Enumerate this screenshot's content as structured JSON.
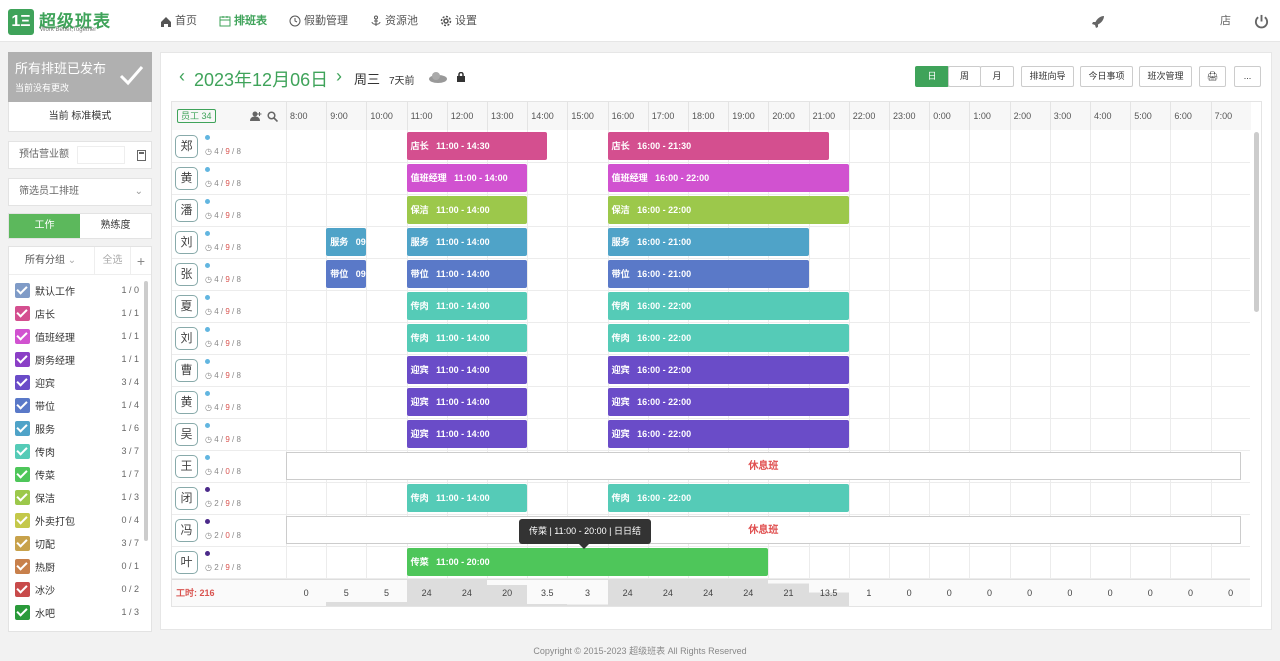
{
  "brand": {
    "logo_letter": "1Ξ",
    "name": "超级班表",
    "tagline": "Work Better,Together"
  },
  "nav": [
    {
      "label": "首页",
      "icon": "home-icon"
    },
    {
      "label": "排班表",
      "icon": "calendar-icon",
      "active": true
    },
    {
      "label": "假勤管理",
      "icon": "clock-icon"
    },
    {
      "label": "资源池",
      "icon": "anchor-icon"
    },
    {
      "label": "设置",
      "icon": "gear-icon"
    }
  ],
  "top_right": {
    "store_label": "店"
  },
  "publish": {
    "title": "所有排班已发布",
    "subtitle": "当前没有更改"
  },
  "mode_label": "当前 标准模式",
  "revenue_label": "预估营业额",
  "filter_label": "筛选员工排班",
  "tabs": [
    "工作",
    "熟练度"
  ],
  "group_head": {
    "all": "所有分组",
    "select_all": "全选",
    "add": "+"
  },
  "groups": [
    {
      "name": "默认工作",
      "count": "1 / 0",
      "color": "#7f9bc7"
    },
    {
      "name": "店长",
      "count": "1 / 1",
      "color": "#d44f8f"
    },
    {
      "name": "值班经理",
      "count": "1 / 1",
      "color": "#d152d0"
    },
    {
      "name": "厨务经理",
      "count": "1 / 1",
      "color": "#8b3fc6"
    },
    {
      "name": "迎宾",
      "count": "3 / 4",
      "color": "#6a4cc8"
    },
    {
      "name": "带位",
      "count": "1 / 4",
      "color": "#5a79c8"
    },
    {
      "name": "服务",
      "count": "1 / 6",
      "color": "#4fa3c8"
    },
    {
      "name": "传肉",
      "count": "3 / 7",
      "color": "#55cbb7"
    },
    {
      "name": "传菜",
      "count": "1 / 7",
      "color": "#4ec65a"
    },
    {
      "name": "保洁",
      "count": "1 / 3",
      "color": "#9cc84b"
    },
    {
      "name": "外卖打包",
      "count": "0 / 4",
      "color": "#c4c84a"
    },
    {
      "name": "切配",
      "count": "3 / 7",
      "color": "#c8a24b"
    },
    {
      "name": "热厨",
      "count": "0 / 1",
      "color": "#c8804b"
    },
    {
      "name": "冰沙",
      "count": "0 / 2",
      "color": "#c84b4b"
    },
    {
      "name": "水吧",
      "count": "1 / 3",
      "color": "#2a9a3a"
    }
  ],
  "date": {
    "title": "2023年12月06日",
    "weekday": "周三",
    "ago": "7天前"
  },
  "view_buttons": [
    "日",
    "周",
    "月"
  ],
  "action_buttons": [
    "排班向导",
    "今日事项",
    "班次管理",
    "🖨",
    "..."
  ],
  "staff_label": "员工",
  "staff_count": "34",
  "hours": [
    "8:00",
    "9:00",
    "10:00",
    "11:00",
    "12:00",
    "13:00",
    "14:00",
    "15:00",
    "16:00",
    "17:00",
    "18:00",
    "19:00",
    "20:00",
    "21:00",
    "22:00",
    "23:00",
    "0:00",
    "1:00",
    "2:00",
    "3:00",
    "4:00",
    "5:00",
    "6:00",
    "7:00"
  ],
  "employees": [
    {
      "name": "郑",
      "stat_a": "4",
      "stat_b": "9",
      "stat_c": "8",
      "dot": "#62b6e0",
      "shifts": [
        {
          "label": "店长",
          "time": "11:00 - 14:30",
          "start": 11,
          "end": 14.5,
          "color": "#d44f8f"
        },
        {
          "label": "店长",
          "time": "16:00 - 21:30",
          "start": 16,
          "end": 21.5,
          "color": "#d44f8f"
        }
      ]
    },
    {
      "name": "黄",
      "stat_a": "4",
      "stat_b": "9",
      "stat_c": "8",
      "dot": "#62b6e0",
      "shifts": [
        {
          "label": "值班经理",
          "time": "11:00 - 14:00",
          "start": 11,
          "end": 14,
          "color": "#d152d0"
        },
        {
          "label": "值班经理",
          "time": "16:00 - 22:00",
          "start": 16,
          "end": 22,
          "color": "#d152d0"
        }
      ]
    },
    {
      "name": "潘",
      "stat_a": "4",
      "stat_b": "9",
      "stat_c": "8",
      "dot": "#62b6e0",
      "shifts": [
        {
          "label": "保洁",
          "time": "11:00 - 14:00",
          "start": 11,
          "end": 14,
          "color": "#9cc84b"
        },
        {
          "label": "保洁",
          "time": "16:00 - 22:00",
          "start": 16,
          "end": 22,
          "color": "#9cc84b"
        }
      ]
    },
    {
      "name": "刘",
      "stat_a": "4",
      "stat_b": "9",
      "stat_c": "8",
      "dot": "#62b6e0",
      "shifts": [
        {
          "label": "服务",
          "time": "09",
          "start": 9,
          "end": 10,
          "color": "#4fa3c8"
        },
        {
          "label": "服务",
          "time": "11:00 - 14:00",
          "start": 11,
          "end": 14,
          "color": "#4fa3c8"
        },
        {
          "label": "服务",
          "time": "16:00 - 21:00",
          "start": 16,
          "end": 21,
          "color": "#4fa3c8"
        }
      ]
    },
    {
      "name": "张",
      "stat_a": "4",
      "stat_b": "9",
      "stat_c": "8",
      "dot": "#62b6e0",
      "shifts": [
        {
          "label": "带位",
          "time": "09",
          "start": 9,
          "end": 10,
          "color": "#5a79c8"
        },
        {
          "label": "带位",
          "time": "11:00 - 14:00",
          "start": 11,
          "end": 14,
          "color": "#5a79c8"
        },
        {
          "label": "带位",
          "time": "16:00 - 21:00",
          "start": 16,
          "end": 21,
          "color": "#5a79c8"
        }
      ]
    },
    {
      "name": "夏",
      "stat_a": "4",
      "stat_b": "9",
      "stat_c": "8",
      "dot": "#62b6e0",
      "shifts": [
        {
          "label": "传肉",
          "time": "11:00 - 14:00",
          "start": 11,
          "end": 14,
          "color": "#55cbb7"
        },
        {
          "label": "传肉",
          "time": "16:00 - 22:00",
          "start": 16,
          "end": 22,
          "color": "#55cbb7"
        }
      ]
    },
    {
      "name": "刘",
      "stat_a": "4",
      "stat_b": "9",
      "stat_c": "8",
      "dot": "#62b6e0",
      "shifts": [
        {
          "label": "传肉",
          "time": "11:00 - 14:00",
          "start": 11,
          "end": 14,
          "color": "#55cbb7"
        },
        {
          "label": "传肉",
          "time": "16:00 - 22:00",
          "start": 16,
          "end": 22,
          "color": "#55cbb7"
        }
      ]
    },
    {
      "name": "曹",
      "stat_a": "4",
      "stat_b": "9",
      "stat_c": "8",
      "dot": "#62b6e0",
      "shifts": [
        {
          "label": "迎宾",
          "time": "11:00 - 14:00",
          "start": 11,
          "end": 14,
          "color": "#6a4cc8"
        },
        {
          "label": "迎宾",
          "time": "16:00 - 22:00",
          "start": 16,
          "end": 22,
          "color": "#6a4cc8"
        }
      ]
    },
    {
      "name": "黄",
      "stat_a": "4",
      "stat_b": "9",
      "stat_c": "8",
      "dot": "#62b6e0",
      "shifts": [
        {
          "label": "迎宾",
          "time": "11:00 - 14:00",
          "start": 11,
          "end": 14,
          "color": "#6a4cc8"
        },
        {
          "label": "迎宾",
          "time": "16:00 - 22:00",
          "start": 16,
          "end": 22,
          "color": "#6a4cc8"
        }
      ]
    },
    {
      "name": "吴",
      "stat_a": "4",
      "stat_b": "9",
      "stat_c": "8",
      "dot": "#62b6e0",
      "shifts": [
        {
          "label": "迎宾",
          "time": "11:00 - 14:00",
          "start": 11,
          "end": 14,
          "color": "#6a4cc8"
        },
        {
          "label": "迎宾",
          "time": "16:00 - 22:00",
          "start": 16,
          "end": 22,
          "color": "#6a4cc8"
        }
      ]
    },
    {
      "name": "王",
      "stat_a": "4",
      "stat_b": "0",
      "stat_c": "8",
      "dot": "#62b6e0",
      "rest": "休息班",
      "shifts": []
    },
    {
      "name": "闭",
      "stat_a": "2",
      "stat_b": "9",
      "stat_c": "8",
      "dot": "#4b2a8a",
      "shifts": [
        {
          "label": "传肉",
          "time": "11:00 - 14:00",
          "start": 11,
          "end": 14,
          "color": "#55cbb7"
        },
        {
          "label": "传肉",
          "time": "16:00 - 22:00",
          "start": 16,
          "end": 22,
          "color": "#55cbb7"
        }
      ]
    },
    {
      "name": "冯",
      "stat_a": "2",
      "stat_b": "0",
      "stat_c": "8",
      "dot": "#4b2a8a",
      "rest": "休息班",
      "shifts": []
    },
    {
      "name": "叶",
      "stat_a": "2",
      "stat_b": "9",
      "stat_c": "8",
      "dot": "#4b2a8a",
      "shifts": [
        {
          "label": "传菜",
          "time": "11:00 - 20:00",
          "start": 11,
          "end": 20,
          "color": "#4ec65a"
        }
      ]
    }
  ],
  "tooltip": "传菜 | 11:00 - 20:00 | 日日结",
  "totals_label": "工时: 216",
  "totals": [
    "0",
    "5",
    "5",
    "24",
    "24",
    "20",
    "3.5",
    "3",
    "24",
    "24",
    "24",
    "24",
    "21",
    "13.5",
    "1",
    "0",
    "0",
    "0",
    "0",
    "0",
    "0",
    "0",
    "0",
    "0"
  ],
  "footer": "Copyright © 2015-2023 超级班表 All Rights Reserved"
}
